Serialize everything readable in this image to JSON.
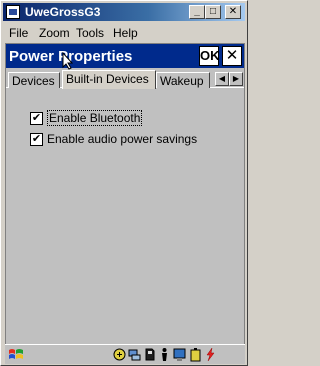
{
  "window": {
    "title": "UweGrossG3",
    "min_label": "_",
    "max_label": "□",
    "close_label": "✕"
  },
  "menu": {
    "items": [
      "File",
      "Zoom",
      "Tools",
      "Help"
    ]
  },
  "dialog": {
    "title": "Power Properties",
    "ok_label": "OK",
    "close_label": "✕",
    "tabs": [
      {
        "label": "Devices",
        "active": false
      },
      {
        "label": "Built-in Devices",
        "active": true
      },
      {
        "label": "Wakeup",
        "active": false
      }
    ],
    "tab_scroll": {
      "left": "◀",
      "right": "▶"
    },
    "options": [
      {
        "label": "Enable Bluetooth",
        "checked": true
      },
      {
        "label": "Enable audio power savings",
        "checked": true
      }
    ],
    "check_mark": "✔"
  },
  "taskbar": {
    "tray_icons": [
      "usb-icon",
      "network-icon",
      "sd-card-icon",
      "person-icon",
      "monitor-icon",
      "battery-icon",
      "power-icon"
    ]
  },
  "colors": {
    "dialog_title_bg": "#002a8c",
    "window_title_start": "#0a246a",
    "face": "#c0c0c0"
  }
}
